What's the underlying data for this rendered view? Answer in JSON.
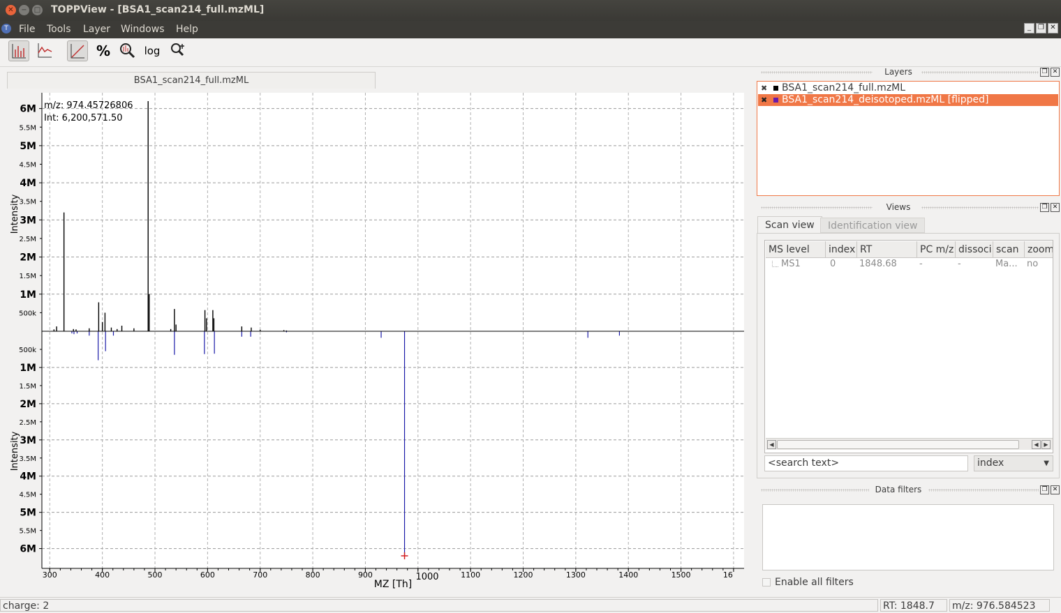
{
  "window": {
    "title": "TOPPView - [BSA1_scan214_full.mzML]"
  },
  "menu": {
    "items": [
      "File",
      "Tools",
      "Layer",
      "Windows",
      "Help"
    ]
  },
  "toolbar": {
    "buttons": [
      {
        "icon": "peak-mode-icon",
        "active": true
      },
      {
        "icon": "raw-mode-icon",
        "active": false
      },
      {
        "icon": "linear-intensity-icon",
        "active": true
      },
      {
        "icon": "percentage-icon",
        "label": "%"
      },
      {
        "icon": "snap-zoom-icon"
      },
      {
        "icon": "log-icon",
        "label": "log"
      },
      {
        "icon": "align-spectra-icon"
      }
    ]
  },
  "document_tab": "BSA1_scan214_full.mzML",
  "plot": {
    "tooltip_line1": "m/z:  974.45726806",
    "tooltip_line2": "Int:  6,200,571.50",
    "y_label_top": "Intensity",
    "y_label_bottom": "Intensity",
    "x_label": "MZ [Th]",
    "cursor_mz_label": "1000",
    "y_ticks_major": [
      "6M",
      "5M",
      "4M",
      "3M",
      "2M",
      "1M"
    ],
    "y_ticks_minor": [
      "5.5M",
      "4.5M",
      "3.5M",
      "2.5M",
      "1.5M",
      "500k"
    ],
    "colors": {
      "top_peaks": "#000000",
      "bottom_peaks": "#1a1aa8",
      "cursor": "#d42020"
    }
  },
  "chart_data": {
    "type": "bar",
    "title": "",
    "xlabel": "MZ [Th]",
    "ylabel": "Intensity",
    "xlim": [
      285,
      1620
    ],
    "ylim": [
      0,
      6200000
    ],
    "x_ticks": [
      "300",
      "400",
      "500",
      "600",
      "700",
      "800",
      "900",
      "1000",
      "1100",
      "1200",
      "1300",
      "1400",
      "1500",
      "16"
    ],
    "series": [
      {
        "name": "BSA1_scan214_full.mzML",
        "direction": "up",
        "x": [
          308,
          313,
          327,
          345,
          350,
          375,
          393,
          400,
          405,
          417,
          428,
          437,
          460,
          487,
          489,
          530,
          537,
          540,
          595,
          598,
          610,
          612,
          665,
          683,
          700,
          745,
          750
        ],
        "y": [
          50000,
          130000,
          3200000,
          60000,
          50000,
          80000,
          780000,
          250000,
          500000,
          100000,
          60000,
          150000,
          80000,
          6200571.5,
          1000000,
          60000,
          600000,
          180000,
          570000,
          350000,
          570000,
          350000,
          130000,
          100000,
          40000,
          30000,
          20000
        ]
      },
      {
        "name": "BSA1_scan214_deisotoped.mzML [flipped]",
        "direction": "down",
        "x": [
          342,
          346,
          352,
          375,
          392,
          406,
          421,
          537,
          594,
          613,
          665,
          682,
          750,
          930,
          974.457,
          1323,
          1383
        ],
        "y": [
          60000,
          80000,
          60000,
          120000,
          800000,
          550000,
          120000,
          650000,
          630000,
          620000,
          150000,
          150000,
          30000,
          180000,
          6200571.5,
          180000,
          120000
        ]
      }
    ]
  },
  "layers_panel": {
    "title": "Layers",
    "items": [
      {
        "name": "BSA1_scan214_full.mzML",
        "color": "#000000",
        "selected": false
      },
      {
        "name": "BSA1_scan214_deisotoped.mzML [flipped]",
        "color": "#6a1aa8",
        "selected": true
      }
    ]
  },
  "views_panel": {
    "title": "Views",
    "tabs": [
      "Scan view",
      "Identification view"
    ],
    "columns": [
      "MS level",
      "index",
      "RT",
      "PC m/z",
      "dissoci",
      "scan",
      "zoom"
    ],
    "rows": [
      [
        "MS1",
        "0",
        "1848.68",
        "-",
        "-",
        "Ma...",
        "no"
      ]
    ],
    "search_placeholder": "<search text>",
    "search_field_selected": "index"
  },
  "filters_panel": {
    "title": "Data filters",
    "enable_all_label": "Enable all filters"
  },
  "status": {
    "left": "charge: 2",
    "rt": "RT:   1848.7",
    "mz": "m/z: 976.584523"
  }
}
